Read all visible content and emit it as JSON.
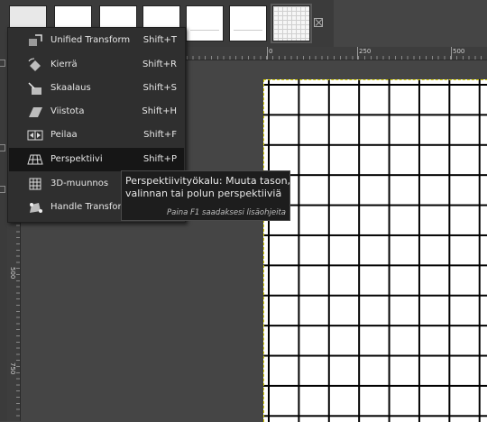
{
  "menu": {
    "items": [
      {
        "label": "Unified Transform",
        "shortcut": "Shift+T",
        "icon": "unified-transform-icon"
      },
      {
        "label": "Kierrä",
        "shortcut": "Shift+R",
        "icon": "rotate-icon"
      },
      {
        "label": "Skaalaus",
        "shortcut": "Shift+S",
        "icon": "scale-icon"
      },
      {
        "label": "Viistota",
        "shortcut": "Shift+H",
        "icon": "shear-icon"
      },
      {
        "label": "Peilaa",
        "shortcut": "Shift+F",
        "icon": "flip-icon"
      },
      {
        "label": "Perspektiivi",
        "shortcut": "Shift+P",
        "icon": "perspective-icon",
        "active": true
      },
      {
        "label": "3D-muunnos",
        "shortcut": "",
        "icon": "3d-transform-icon"
      },
      {
        "label": "Handle Transform",
        "shortcut": "",
        "icon": "handle-transform-icon"
      }
    ]
  },
  "tooltip": {
    "line1": "Perspektiivityökalu: Muuta tason,",
    "line2": "valinnan tai polun perspektiiviä",
    "hint": "Paina F1 saadaksesi lisäohjeita"
  },
  "ruler": {
    "h_labels": [
      "0",
      "250",
      "500"
    ],
    "v_labels": [
      "500",
      "750"
    ]
  },
  "colors": {
    "accent": "#d9d200",
    "menu_bg": "#2f2f2f",
    "canvas_bg": "#454545"
  }
}
